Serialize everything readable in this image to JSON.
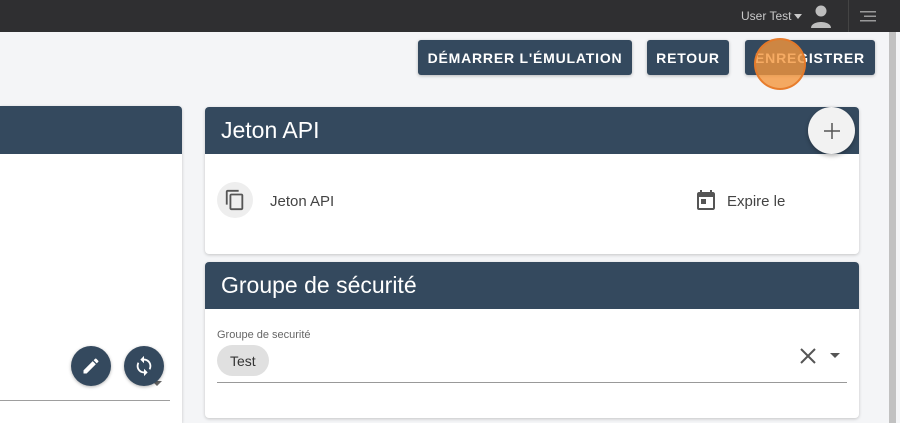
{
  "topbar": {
    "user_name": "User Test"
  },
  "toolbar": {
    "emulation_label": "DÉMARRER L'ÉMULATION",
    "back_label": "RETOUR",
    "save_label": "ENREGISTRER"
  },
  "api_card": {
    "title": "Jeton API",
    "columns": {
      "token_label": "Jeton API",
      "expires_label": "Expire le"
    }
  },
  "security_card": {
    "title": "Groupe de sécurité",
    "field_label": "Groupe de securité",
    "selected": [
      "Test"
    ]
  },
  "colors": {
    "primary": "#34495e",
    "topbar": "#2f2f31",
    "ripple": "#f4963c"
  },
  "icons": [
    "user-avatar-icon",
    "menu-icon",
    "plus-icon",
    "copy-icon",
    "calendar-icon",
    "close-icon",
    "pencil-icon",
    "sync-icon"
  ]
}
